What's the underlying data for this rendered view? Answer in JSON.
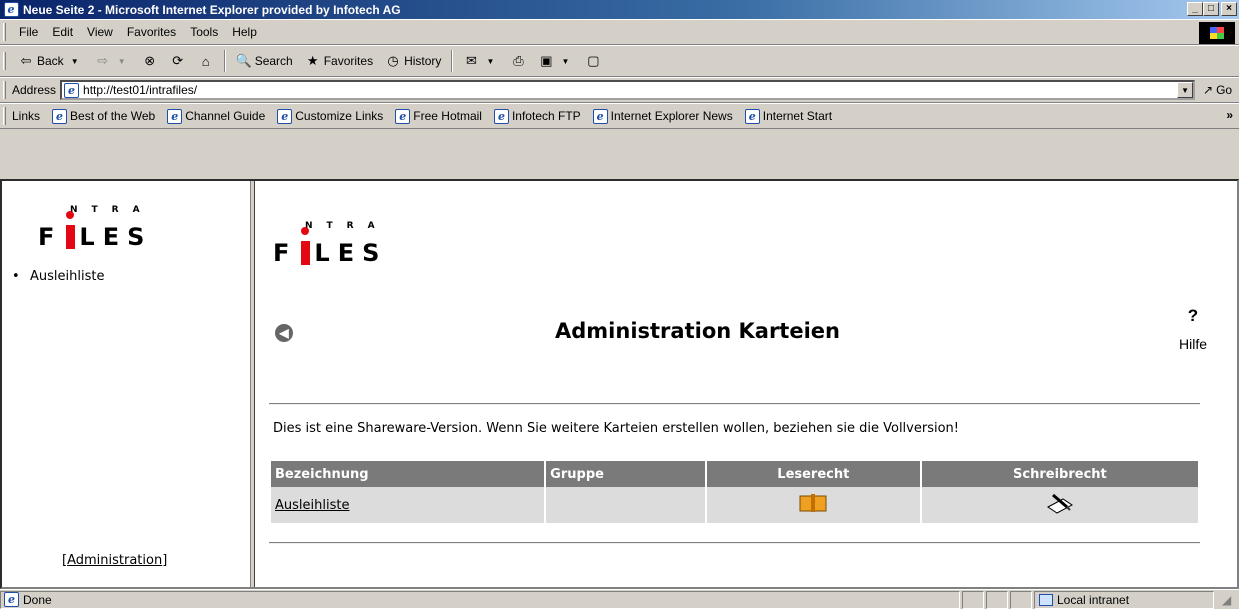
{
  "window": {
    "title": "Neue Seite 2 - Microsoft Internet Explorer provided by Infotech AG",
    "buttons": {
      "minimize": "_",
      "maximize": "□",
      "close": "×"
    }
  },
  "menubar": {
    "items": [
      "File",
      "Edit",
      "View",
      "Favorites",
      "Tools",
      "Help"
    ]
  },
  "toolbar": {
    "back": "Back",
    "search": "Search",
    "favorites": "Favorites",
    "history": "History"
  },
  "address": {
    "label": "Address",
    "value": "http://test01/intrafiles/",
    "go": "Go"
  },
  "links": {
    "label": "Links",
    "items": [
      "Best of the Web",
      "Channel Guide",
      "Customize Links",
      "Free Hotmail",
      "Infotech FTP",
      "Internet Explorer News",
      "Internet Start"
    ],
    "more": "»"
  },
  "logo": {
    "ntra": "NTRA",
    "f": "F",
    "les": "LES"
  },
  "sidebar": {
    "items": [
      "Ausleihliste"
    ],
    "admin_link": "Administration",
    "admin_open": "[",
    "admin_close": "]"
  },
  "main": {
    "title": "Administration Karteien",
    "help_symbol": "?",
    "help_label": "Hilfe",
    "notice": "Dies ist eine Shareware-Version. Wenn Sie weitere Karteien erstellen wollen, beziehen sie die Vollversion!",
    "table": {
      "headers": [
        "Bezeichnung",
        "Gruppe",
        "Leserecht",
        "Schreibrecht"
      ],
      "rows": [
        {
          "name": "Ausleihliste",
          "group": ""
        }
      ]
    }
  },
  "statusbar": {
    "status": "Done",
    "zone": "Local intranet"
  }
}
